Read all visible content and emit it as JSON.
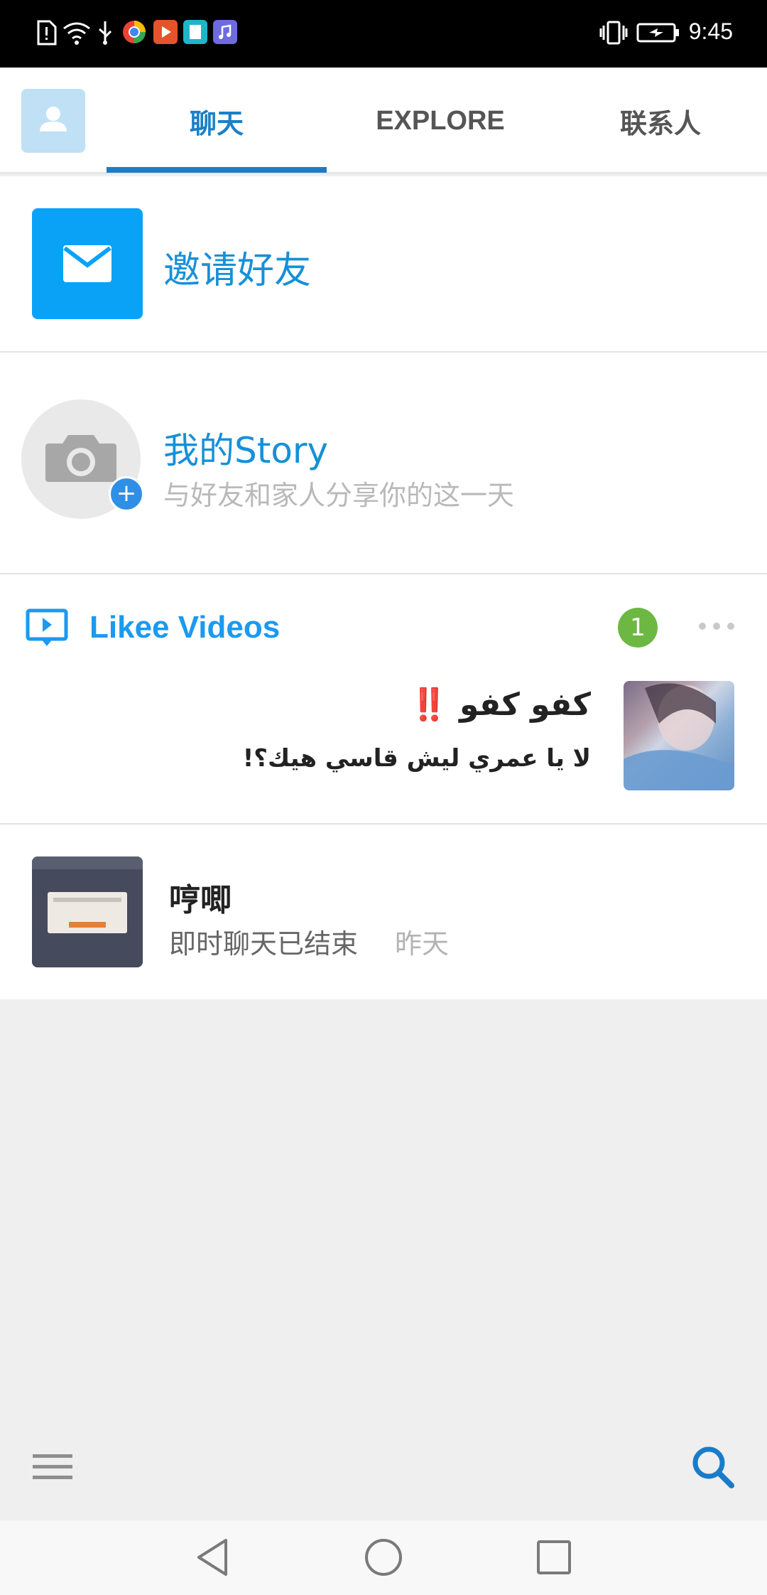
{
  "status_bar": {
    "time": "9:45",
    "icons": [
      "notification-alert-icon",
      "wifi-icon",
      "usb-icon",
      "browser-app-icon",
      "video-app-icon",
      "book-app-icon",
      "music-app-icon",
      "vibrate-icon",
      "battery-charging-icon"
    ]
  },
  "top_nav": {
    "avatar_icon": "person-icon",
    "tabs": [
      {
        "label": "聊天",
        "active": true
      },
      {
        "label": "EXPLORE",
        "active": false
      },
      {
        "label": "联系人",
        "active": false
      }
    ]
  },
  "invite": {
    "icon": "mail-icon",
    "label": "邀请好友"
  },
  "story": {
    "icon": "camera-icon",
    "plus": "+",
    "title": "我的Story",
    "subtitle": "与好友和家人分享你的这一天"
  },
  "likee": {
    "icon": "play-video-icon",
    "title": "Likee Videos",
    "badge": "1",
    "video": {
      "title": "كفو كفو ‼️",
      "subtitle": "لا يا عمري ليش قاسي هيك؟!"
    }
  },
  "chat": {
    "name": "哼唧",
    "message": "即时聊天已结束",
    "time": "昨天"
  },
  "bottom_toolbar": {
    "menu_icon": "hamburger-menu-icon",
    "search_icon": "search-icon"
  },
  "nav_bar": {
    "buttons": [
      "back-icon",
      "home-icon",
      "recents-icon"
    ]
  },
  "colors": {
    "accent": "#1690d8",
    "invite_tile": "#0aa2f7",
    "badge": "#6cb842",
    "background": "#efeff0"
  }
}
